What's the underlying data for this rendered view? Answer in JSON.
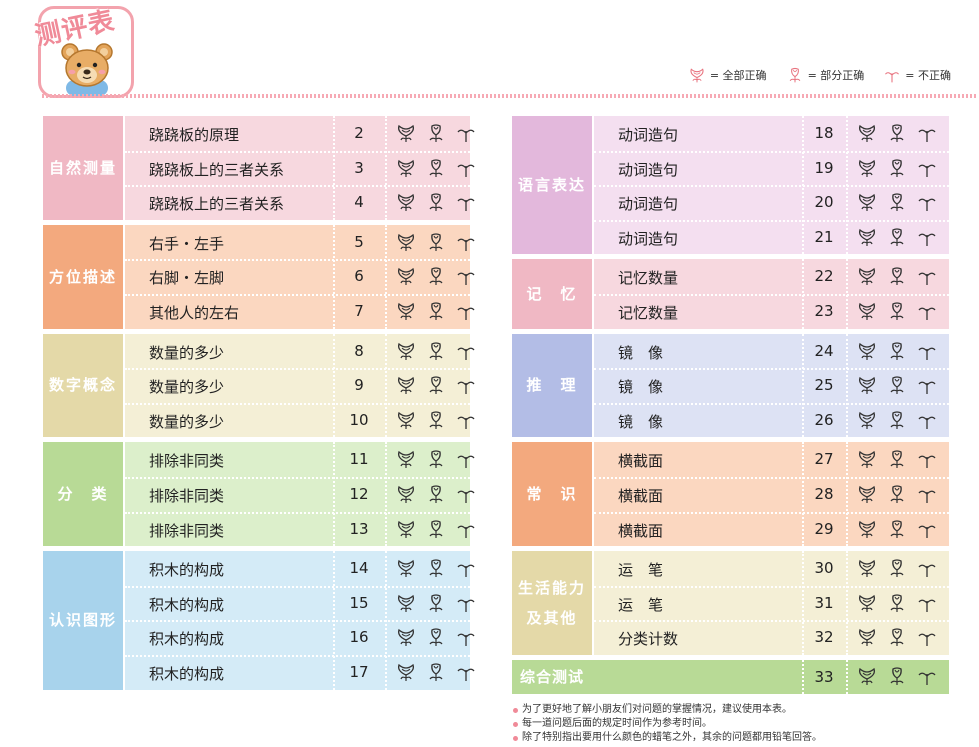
{
  "title": "测评表",
  "legend": [
    {
      "icon": "full-correct-icon",
      "label": "= 全部正确"
    },
    {
      "icon": "partial-correct-icon",
      "label": "= 部分正确"
    },
    {
      "icon": "incorrect-icon",
      "label": "= 不正确"
    }
  ],
  "left_groups": [
    {
      "category": "自然测量",
      "color": "#f0b8c4",
      "row_color": "#f7d8df",
      "rows": [
        {
          "item": "跷跷板的原理",
          "num": "2"
        },
        {
          "item": "跷跷板上的三者关系",
          "num": "3"
        },
        {
          "item": "跷跷板上的三者关系",
          "num": "4"
        }
      ]
    },
    {
      "category": "方位描述",
      "color": "#f3a97e",
      "row_color": "#fbd7c0",
      "rows": [
        {
          "item": "右手・左手",
          "num": "5"
        },
        {
          "item": "右脚・左脚",
          "num": "6"
        },
        {
          "item": "其他人的左右",
          "num": "7"
        }
      ]
    },
    {
      "category": "数字概念",
      "color": "#e4d9a8",
      "row_color": "#f4efd6",
      "rows": [
        {
          "item": "数量的多少",
          "num": "8"
        },
        {
          "item": "数量的多少",
          "num": "9"
        },
        {
          "item": "数量的多少",
          "num": "10"
        }
      ]
    },
    {
      "category": "分　类",
      "color": "#b8da96",
      "row_color": "#dcefcb",
      "rows": [
        {
          "item": "排除非同类",
          "num": "11"
        },
        {
          "item": "排除非同类",
          "num": "12"
        },
        {
          "item": "排除非同类",
          "num": "13"
        }
      ]
    },
    {
      "category": "认识图形",
      "color": "#a8d3ec",
      "row_color": "#d4ebf7",
      "rows": [
        {
          "item": "积木的构成",
          "num": "14"
        },
        {
          "item": "积木的构成",
          "num": "15"
        },
        {
          "item": "积木的构成",
          "num": "16"
        },
        {
          "item": "积木的构成",
          "num": "17"
        }
      ]
    }
  ],
  "right_groups": [
    {
      "category": "语言表达",
      "color": "#e3b8dc",
      "row_color": "#f4dff0",
      "rows": [
        {
          "item": "动词造句",
          "num": "18"
        },
        {
          "item": "动词造句",
          "num": "19"
        },
        {
          "item": "动词造句",
          "num": "20"
        },
        {
          "item": "动词造句",
          "num": "21"
        }
      ]
    },
    {
      "category": "记　忆",
      "color": "#f0b8c4",
      "row_color": "#f7d8df",
      "rows": [
        {
          "item": "记忆数量",
          "num": "22"
        },
        {
          "item": "记忆数量",
          "num": "23"
        }
      ]
    },
    {
      "category": "推　理",
      "color": "#b3bde6",
      "row_color": "#dde2f4",
      "rows": [
        {
          "item": "镜　像",
          "num": "24"
        },
        {
          "item": "镜　像",
          "num": "25"
        },
        {
          "item": "镜　像",
          "num": "26"
        }
      ]
    },
    {
      "category": "常　识",
      "color": "#f3a97e",
      "row_color": "#fbd7c0",
      "rows": [
        {
          "item": "横截面",
          "num": "27"
        },
        {
          "item": "横截面",
          "num": "28"
        },
        {
          "item": "横截面",
          "num": "29"
        }
      ]
    },
    {
      "category": "生活能力\n及其他",
      "color": "#e4d9a8",
      "row_color": "#f4efd6",
      "rows": [
        {
          "item": "运　笔",
          "num": "30"
        },
        {
          "item": "运　笔",
          "num": "31"
        },
        {
          "item": "分类计数",
          "num": "32"
        }
      ]
    },
    {
      "category": "综合测试",
      "color": "#b8da96",
      "row_color": "#dcefcb",
      "single": true,
      "rows": [
        {
          "item": "",
          "num": "33"
        }
      ]
    }
  ],
  "notes": [
    "为了更好地了解小朋友们对问题的掌握情况，建议使用本表。",
    "每一道问题后面的规定时间作为参考时间。",
    "除了特别指出要用什么颜色的蜡笔之外，其余的问题都用铅笔回答。"
  ]
}
